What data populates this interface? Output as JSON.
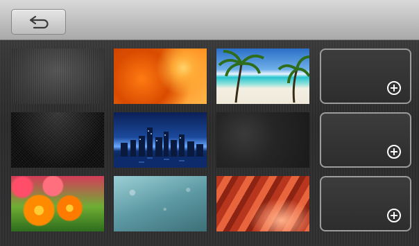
{
  "header": {
    "back_button_icon": "back-arrow-icon"
  },
  "wallpapers": [
    {
      "name": "brushed-metal-gray",
      "selected": false
    },
    {
      "name": "autumn-leaves",
      "selected": false
    },
    {
      "name": "tropical-beach",
      "selected": false
    },
    {
      "name": "dark-mesh",
      "selected": false
    },
    {
      "name": "city-skyline-night",
      "selected": false
    },
    {
      "name": "dark-slate",
      "selected": false
    },
    {
      "name": "gerbera-flowers",
      "selected": false
    },
    {
      "name": "raindrops-glass",
      "selected": false
    },
    {
      "name": "red-canyon",
      "selected": false
    }
  ],
  "add_slots": [
    {
      "icon": "add-circle-icon"
    },
    {
      "icon": "add-circle-icon"
    },
    {
      "icon": "add-circle-icon"
    }
  ],
  "colors": {
    "topbar": "#c4c4c4",
    "background": "#2e2e2f",
    "slot_border": "#9c9c9c",
    "plus": "#ffffff"
  }
}
